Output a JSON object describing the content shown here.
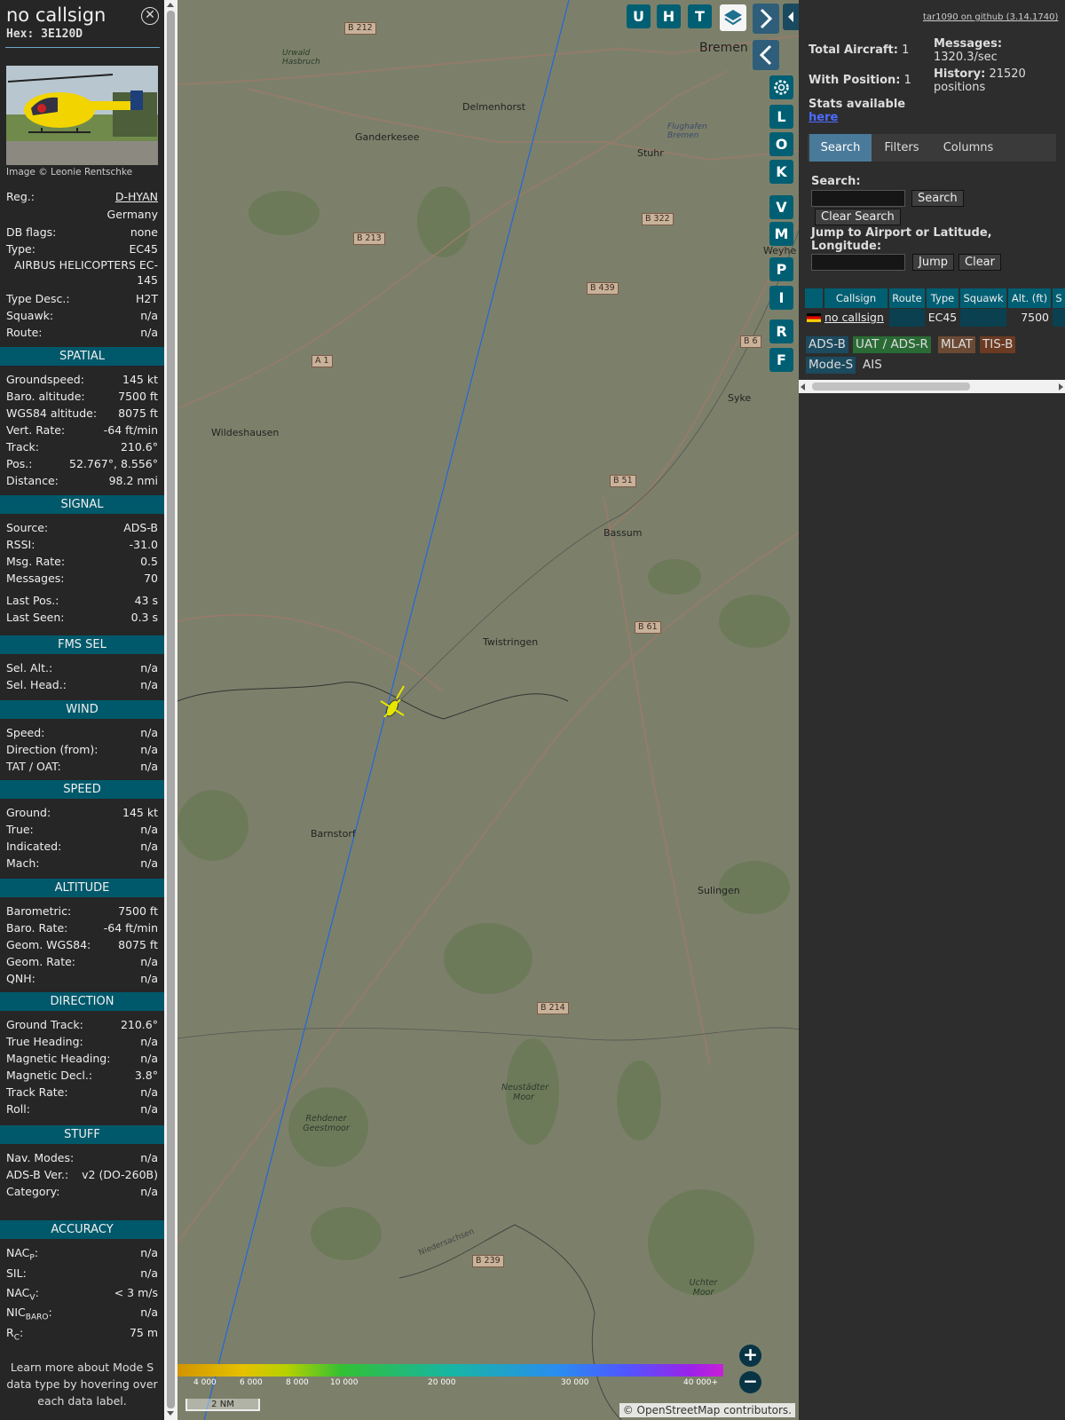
{
  "info": {
    "callsign": "no callsign",
    "hex": "Hex: 3E120D",
    "photo_credit": "Image © Leonie Rentschke",
    "reg_label": "Reg.:",
    "reg": "D-HYAN",
    "country": "Germany",
    "dbflags_label": "DB flags:",
    "dbflags": "none",
    "type_label": "Type:",
    "type": "EC45",
    "type_full": "AIRBUS HELICOPTERS EC-145",
    "typedesc_label": "Type Desc.:",
    "typedesc": "H2T",
    "squawk_label": "Squawk:",
    "squawk": "n/a",
    "route_label": "Route:",
    "route": "n/a"
  },
  "spatial": {
    "heading": "SPATIAL",
    "rows": [
      {
        "k": "Groundspeed:",
        "v": "145 kt"
      },
      {
        "k": "Baro. altitude:",
        "v": "7500 ft"
      },
      {
        "k": "WGS84 altitude:",
        "v": "8075 ft"
      },
      {
        "k": "Vert. Rate:",
        "v": "-64 ft/min"
      },
      {
        "k": "Track:",
        "v": "210.6°"
      },
      {
        "k": "Pos.:",
        "v": "52.767°, 8.556°"
      },
      {
        "k": "Distance:",
        "v": "98.2 nmi"
      }
    ]
  },
  "signal": {
    "heading": "SIGNAL",
    "rows": [
      {
        "k": "Source:",
        "v": "ADS-B"
      },
      {
        "k": "RSSI:",
        "v": "-31.0"
      },
      {
        "k": "Msg. Rate:",
        "v": "0.5"
      },
      {
        "k": "Messages:",
        "v": "70"
      },
      {
        "k": "Last Pos.:",
        "v": "43 s"
      },
      {
        "k": "Last Seen:",
        "v": "0.3 s"
      }
    ]
  },
  "fms": {
    "heading": "FMS SEL",
    "rows": [
      {
        "k": "Sel. Alt.:",
        "v": "n/a"
      },
      {
        "k": "Sel. Head.:",
        "v": "n/a"
      }
    ]
  },
  "wind": {
    "heading": "WIND",
    "rows": [
      {
        "k": "Speed:",
        "v": "n/a"
      },
      {
        "k": "Direction (from):",
        "v": "n/a"
      },
      {
        "k": "TAT / OAT:",
        "v": "n/a"
      }
    ]
  },
  "speed": {
    "heading": "SPEED",
    "rows": [
      {
        "k": "Ground:",
        "v": "145 kt"
      },
      {
        "k": "True:",
        "v": "n/a"
      },
      {
        "k": "Indicated:",
        "v": "n/a"
      },
      {
        "k": "Mach:",
        "v": "n/a"
      }
    ]
  },
  "altitude": {
    "heading": "ALTITUDE",
    "rows": [
      {
        "k": "Barometric:",
        "v": "7500 ft"
      },
      {
        "k": "Baro. Rate:",
        "v": "-64 ft/min"
      },
      {
        "k": "Geom. WGS84:",
        "v": "8075 ft"
      },
      {
        "k": "Geom. Rate:",
        "v": "n/a"
      },
      {
        "k": "QNH:",
        "v": "n/a"
      }
    ]
  },
  "direction": {
    "heading": "DIRECTION",
    "rows": [
      {
        "k": "Ground Track:",
        "v": "210.6°"
      },
      {
        "k": "True Heading:",
        "v": "n/a"
      },
      {
        "k": "Magnetic Heading:",
        "v": "n/a"
      },
      {
        "k": "Magnetic Decl.:",
        "v": "3.8°"
      },
      {
        "k": "Track Rate:",
        "v": "n/a"
      },
      {
        "k": "Roll:",
        "v": "n/a"
      }
    ]
  },
  "stuff": {
    "heading": "STUFF",
    "rows": [
      {
        "k": "Nav. Modes:",
        "v": "n/a"
      },
      {
        "k": "ADS-B Ver.:",
        "v": "v2 (DO-260B)"
      },
      {
        "k": "Category:",
        "v": "n/a"
      }
    ]
  },
  "accuracy": {
    "heading": "ACCURACY",
    "nacp_k": "NAC",
    "nacp_sub": "P",
    "nacp_v": "n/a",
    "sil_k": "SIL:",
    "sil_v": "n/a",
    "nacv_k": "NAC",
    "nacv_sub": "V",
    "nacv_v": "< 3 m/s",
    "nicbaro_k": "NIC",
    "nicbaro_sub": "BARO",
    "nicbaro_v": "n/a",
    "rc_k": "R",
    "rc_sub": "C",
    "rc_v": "75 m"
  },
  "note": "Learn more about Mode S data type by hovering over each data label.",
  "map": {
    "top_buttons": [
      "U",
      "H",
      "T"
    ],
    "side_buttons": [
      "L",
      "O",
      "K",
      "V",
      "M",
      "P",
      "I",
      "R",
      "F"
    ],
    "zoom_in": "+",
    "zoom_out": "−",
    "scale": "2 NM",
    "attribution": "© OpenStreetMap contributors.",
    "alt_ticks": [
      "4 000",
      "6 000",
      "8 000",
      "10 000",
      "20 000",
      "30 000",
      "40 000+"
    ],
    "places": [
      {
        "name": "Bremen"
      },
      {
        "name": "Delmenhorst"
      },
      {
        "name": "Ganderkesee"
      },
      {
        "name": "Stuhr"
      },
      {
        "name": "Wildeshausen"
      },
      {
        "name": "Bassum"
      },
      {
        "name": "Twistringen"
      },
      {
        "name": "Barnstorf"
      },
      {
        "name": "Sulingen"
      },
      {
        "name": "Syke"
      },
      {
        "name": "Flughafen Bremen"
      },
      {
        "name": "Urwald Hasbruch"
      },
      {
        "name": "Neustädter Moor"
      },
      {
        "name": "Rehdener Geestmoor"
      },
      {
        "name": "Uchter Moor"
      },
      {
        "name": "Niedersachsen"
      },
      {
        "name": "Weyhe"
      }
    ],
    "roads": [
      "B 212",
      "B 213",
      "B 322",
      "B 439",
      "A 1",
      "B 6",
      "B 51",
      "B 61",
      "B 214",
      "B 239"
    ]
  },
  "right": {
    "github": "tar1090 on github (3.14.1740)",
    "total_label": "Total Aircraft:",
    "total": "1",
    "withpos_label": "With Position:",
    "withpos": "1",
    "stats_label": "Stats available",
    "stats_link": "here",
    "messages_label": "Messages:",
    "messages": "1320.3/sec",
    "history_label": "History:",
    "history": "21520 positions",
    "tabs": [
      "Search",
      "Filters",
      "Columns"
    ],
    "search_label": "Search:",
    "search_btn": "Search",
    "clear_search_btn": "Clear Search",
    "jump_label": "Jump to Airport or Latitude, Longitude:",
    "jump_btn": "Jump",
    "clear_btn": "Clear",
    "columns": [
      "Callsign",
      "Route",
      "Type",
      "Squawk",
      "Alt. (ft)",
      "S"
    ],
    "row": {
      "callsign": "no callsign",
      "route": "",
      "type": "EC45",
      "squawk": "",
      "alt": "7500"
    },
    "sources": [
      "ADS-B",
      "UAT / ADS-R",
      "MLAT",
      "TIS-B",
      "Mode-S",
      "AIS"
    ]
  },
  "colors": {
    "accent": "#005f73",
    "aircraft": "#e6e600",
    "track": "#2266dd"
  }
}
